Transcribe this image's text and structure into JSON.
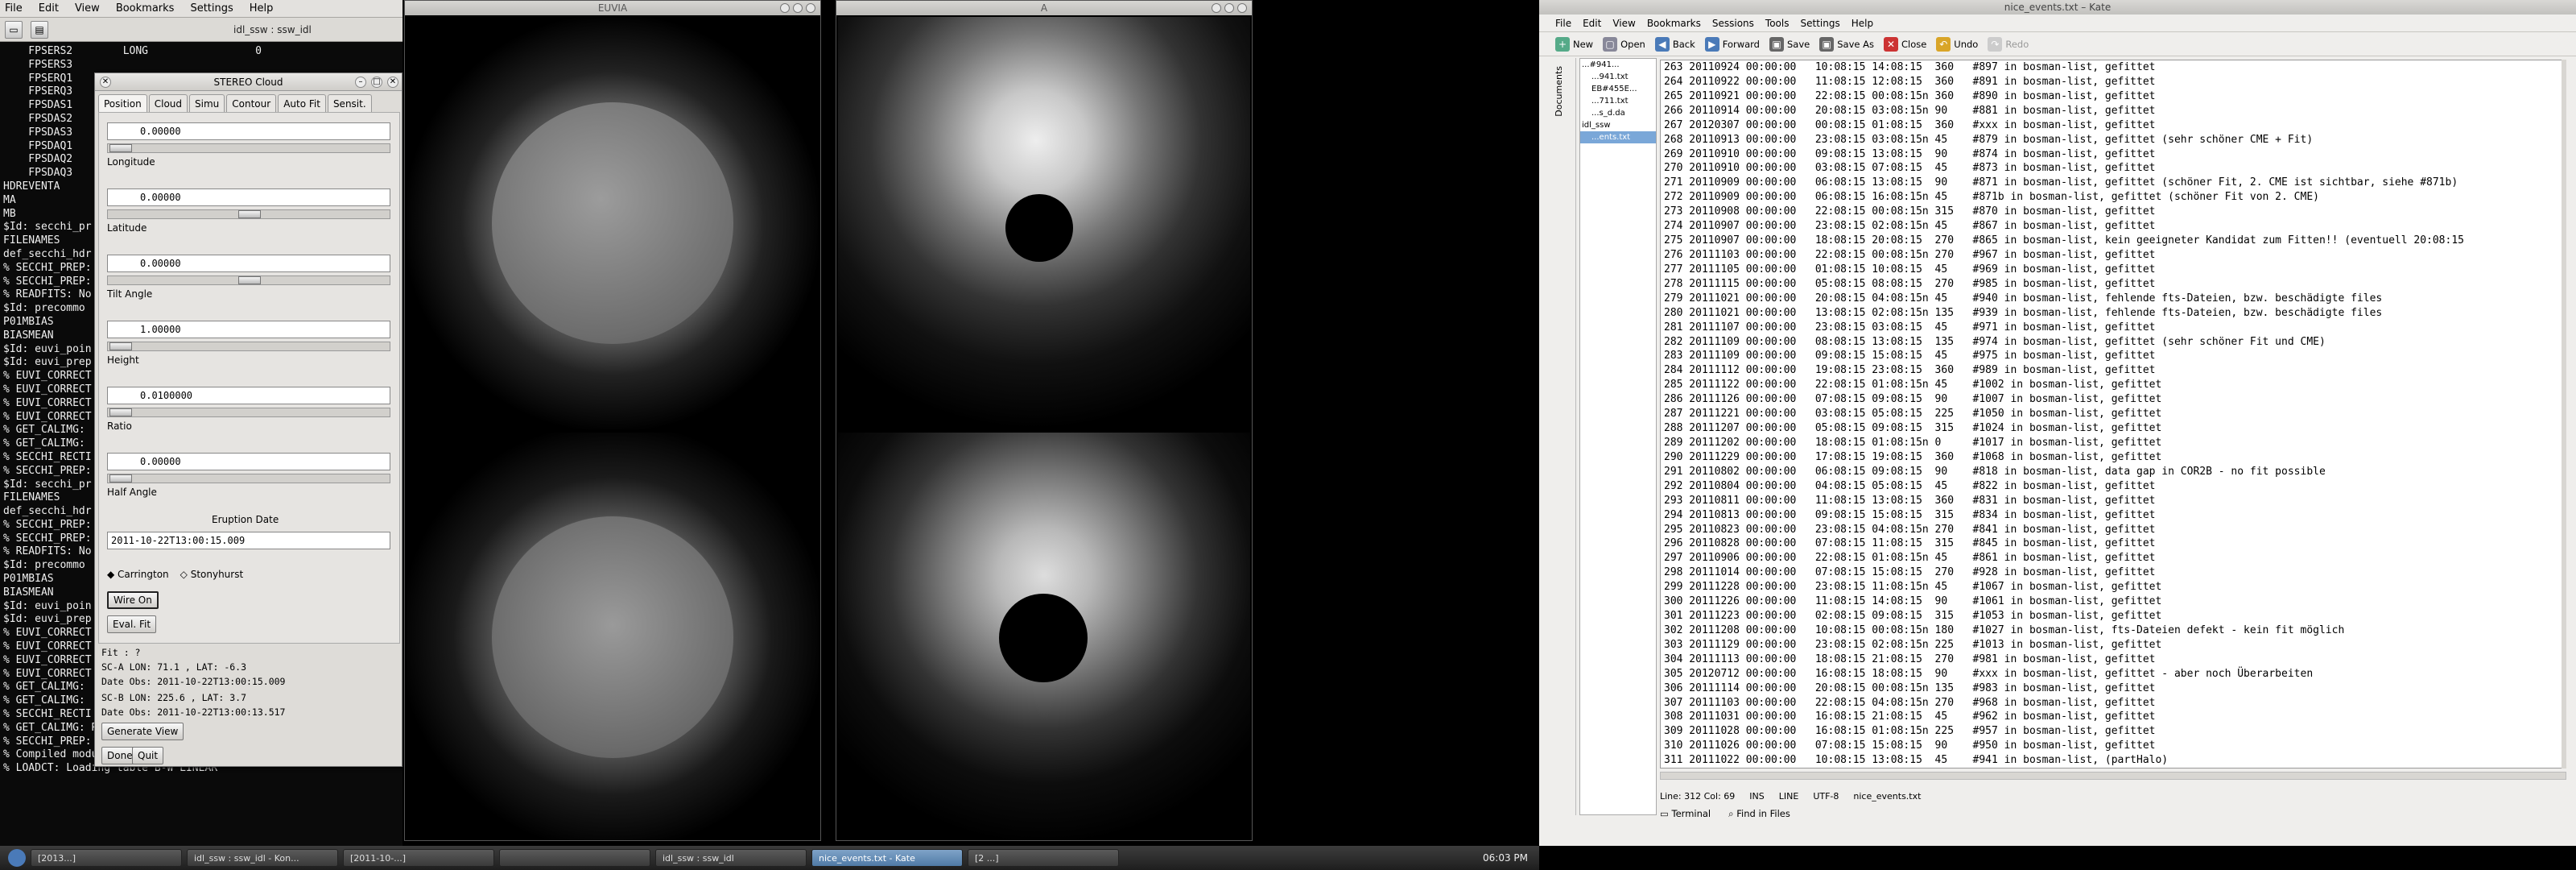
{
  "terminal": {
    "menu": [
      "File",
      "Edit",
      "View",
      "Bookmarks",
      "Settings",
      "Help"
    ],
    "title": "idl_ssw : ssw_idl",
    "lines": [
      "    FPSERS2        LONG                 0",
      "    FPSERS3",
      "    FPSERQ1",
      "",
      "    FPSERQ3",
      "    FPSDAS1",
      "    FPSDAS2",
      "    FPSDAS3",
      "    FPSDAQ1",
      "    FPSDAQ2",
      "    FPSDAQ3",
      "HDREVENTA",
      "MA",
      "MB",
      "",
      "$Id: secchi_pr",
      "FILENAMES",
      "def_secchi_hdr",
      "% SECCHI_PREP:",
      "% SECCHI_PREP:",
      "% READFITS: No",
      "$Id: precommo",
      "P01MBIAS",
      "BIASMEAN",
      "$Id: euvi_poin",
      "$Id: euvi_prep",
      "% EUVI_CORRECT",
      "% EUVI_CORRECT",
      "% EUVI_CORRECT",
      "% EUVI_CORRECT",
      "% GET_CALIMG:",
      "% GET_CALIMG:",
      "% SECCHI_RECTI",
      "% SECCHI_PREP:",
      "",
      "$Id: secchi_pr",
      "FILENAMES",
      "def_secchi_hdr",
      "% SECCHI_PREP:",
      "% SECCHI_PREP:",
      "% READFITS: No",
      "$Id: precommo",
      "P01MBIAS",
      "BIASMEAN",
      "$Id: euvi_poin",
      "$Id: euvi_prep",
      "% EUVI_CORRECT",
      "% EUVI_CORRECT",
      "% EUVI_CORRECT",
      "% EUVI_CORRECT",
      "% GET_CALIMG:",
      "% GET_CALIMG:",
      "% SECCHI_RECTI",
      "% GET_CALIMG: RECTIFIED CALIBRATION IMAGE",
      "% SECCHI_PREP: FINISHED!",
      "% Compiled module: CMECLOUD.",
      "% LOADCT: Loading table B-W LINEAR"
    ]
  },
  "dialog": {
    "title": "STEREO Cloud",
    "tabs": [
      "Position",
      "Cloud",
      "Simu",
      "Contour",
      "Auto Fit",
      "Sensit."
    ],
    "fields": [
      {
        "label": "",
        "value": "0.00000"
      },
      {
        "label": "Longitude",
        "value": "0.00000"
      },
      {
        "label": "Latitude",
        "value": "0.00000"
      },
      {
        "label": "Tilt Angle",
        "value": "1.00000"
      },
      {
        "label": "Height",
        "value": "0.0100000"
      },
      {
        "label": "Ratio",
        "value": "0.00000"
      }
    ],
    "last_label": "Half Angle",
    "eruption_label": "Eruption Date",
    "eruption_value": "2011-10-22T13:00:15.009",
    "radio_carrington": "Carrington",
    "radio_stonyhurst": "Stonyhurst",
    "wire_btn": "Wire On",
    "eval_btn": "Eval. Fit",
    "fit_label": "Fit : ?",
    "sc_a": "SC-A LON:   71.1 , LAT:   -6.3",
    "date_obs_a": "Date Obs: 2011-10-22T13:00:15.009",
    "sc_b": "SC-B LON:  225.6 , LAT:    3.7",
    "date_obs_b": "Date Obs: 2011-10-22T13:00:13.517",
    "generate_btn": "Generate View",
    "done_btn": "Done",
    "quit_btn": "Quit"
  },
  "image_windows": {
    "left_title": "EUVIA",
    "right_title": "A"
  },
  "kate": {
    "title": "nice_events.txt – Kate",
    "menu": [
      "File",
      "Edit",
      "View",
      "Bookmarks",
      "Sessions",
      "Tools",
      "Settings",
      "Help"
    ],
    "toolbar": [
      "New",
      "Open",
      "Back",
      "Forward",
      "Save",
      "Save As",
      "Close",
      "Undo",
      "Redo"
    ],
    "tree_items": [
      "...#941...",
      "...941.txt",
      "EB#455E...",
      "...711.txt",
      "...s_d.da",
      "idl_ssw",
      "...ents.txt"
    ],
    "sidebar_label": "Documents",
    "lines": [
      "263 20110924 00:00:00   10:08:15 14:08:15  360   #897 in bosman-list, gefittet",
      "264 20110922 00:00:00   11:08:15 12:08:15  360   #891 in bosman-list, gefittet",
      "265 20110921 00:00:00   22:08:15 00:08:15n 360   #890 in bosman-list, gefittet",
      "266 20110914 00:00:00   20:08:15 03:08:15n 90    #881 in bosman-list, gefittet",
      "267 20120307 00:00:00   00:08:15 01:08:15  360   #xxx in bosman-list, gefittet",
      "268 20110913 00:00:00   23:08:15 03:08:15n 45    #879 in bosman-list, gefittet (sehr schöner CME + Fit)",
      "269 20110910 00:00:00   09:08:15 13:08:15  90    #874 in bosman-list, gefittet",
      "270 20110910 00:00:00   03:08:15 07:08:15  45    #873 in bosman-list, gefittet",
      "271 20110909 00:00:00   06:08:15 13:08:15  90    #871 in bosman-list, gefittet (schöner Fit, 2. CME ist sichtbar, siehe #871b)",
      "272 20110909 00:00:00   06:08:15 16:08:15n 45    #871b in bosman-list, gefittet (schöner Fit von 2. CME)",
      "273 20110908 00:00:00   22:08:15 00:08:15n 315   #870 in bosman-list, gefittet",
      "274 20110907 00:00:00   23:08:15 02:08:15n 45    #867 in bosman-list, gefittet",
      "275 20110907 00:00:00   18:08:15 20:08:15  270   #865 in bosman-list, kein geeigneter Kandidat zum Fitten!! (eventuell 20:08:15",
      "276 20111103 00:00:00   22:08:15 00:08:15n 270   #967 in bosman-list, gefittet",
      "277 20111105 00:00:00   01:08:15 10:08:15  45    #969 in bosman-list, gefittet",
      "278 20111115 00:00:00   05:08:15 08:08:15  270   #985 in bosman-list, gefittet",
      "279 20111021 00:00:00   20:08:15 04:08:15n 45    #940 in bosman-list, fehlende fts-Dateien, bzw. beschädigte files",
      "280 20111021 00:00:00   13:08:15 02:08:15n 135   #939 in bosman-list, fehlende fts-Dateien, bzw. beschädigte files",
      "281 20111107 00:00:00   23:08:15 03:08:15  45    #971 in bosman-list, gefittet",
      "282 20111109 00:00:00   08:08:15 13:08:15  135   #974 in bosman-list, gefittet (sehr schöner Fit und CME)",
      "283 20111109 00:00:00   09:08:15 15:08:15  45    #975 in bosman-list, gefittet",
      "284 20111112 00:00:00   19:08:15 23:08:15  360   #989 in bosman-list, gefittet",
      "285 20111122 00:00:00   22:08:15 01:08:15n 45    #1002 in bosman-list, gefittet",
      "286 20111126 00:00:00   07:08:15 09:08:15  90    #1007 in bosman-list, gefittet",
      "287 20111221 00:00:00   03:08:15 05:08:15  225   #1050 in bosman-list, gefittet",
      "288 20111207 00:00:00   05:08:15 09:08:15  315   #1024 in bosman-list, gefittet",
      "289 20111202 00:00:00   18:08:15 01:08:15n 0     #1017 in bosman-list, gefittet",
      "290 20111229 00:00:00   17:08:15 19:08:15  360   #1068 in bosman-list, gefittet",
      "291 20110802 00:00:00   06:08:15 09:08:15  90    #818 in bosman-list, data gap in COR2B - no fit possible",
      "292 20110804 00:00:00   04:08:15 05:08:15  45    #822 in bosman-list, gefittet",
      "293 20110811 00:00:00   11:08:15 13:08:15  360   #831 in bosman-list, gefittet",
      "294 20110813 00:00:00   09:08:15 15:08:15  315   #834 in bosman-list, gefittet",
      "295 20110823 00:00:00   23:08:15 04:08:15n 270   #841 in bosman-list, gefittet",
      "296 20110828 00:00:00   07:08:15 11:08:15  315   #845 in bosman-list, gefittet",
      "297 20110906 00:00:00   22:08:15 01:08:15n 45    #861 in bosman-list, gefittet",
      "298 20111014 00:00:00   07:08:15 15:08:15  270   #928 in bosman-list, gefittet",
      "299 20111228 00:00:00   23:08:15 11:08:15n 45    #1067 in bosman-list, gefittet",
      "300 20111226 00:00:00   11:08:15 14:08:15  90    #1061 in bosman-list, gefittet",
      "301 20111223 00:00:00   02:08:15 09:08:15  315   #1053 in bosman-list, gefittet",
      "302 20111208 00:00:00   10:08:15 00:08:15n 180   #1027 in bosman-list, fts-Dateien defekt - kein fit möglich",
      "303 20111129 00:00:00   23:08:15 02:08:15n 225   #1013 in bosman-list, gefittet",
      "304 20111113 00:00:00   18:08:15 21:08:15  270   #981 in bosman-list, gefittet",
      "305 20120712 00:00:00   16:08:15 18:08:15  90    #xxx in bosman-list, gefittet - aber noch Überarbeiten",
      "306 20111114 00:00:00   20:08:15 00:08:15n 135   #983 in bosman-list, gefittet",
      "307 20111103 00:00:00   22:08:15 04:08:15n 270   #968 in bosman-list, gefittet",
      "308 20111031 00:00:00   16:08:15 21:08:15  45    #962 in bosman-list, gefittet",
      "309 20111028 00:00:00   16:08:15 01:08:15n 225   #957 in bosman-list, gefittet",
      "310 20111026 00:00:00   07:08:15 15:08:15  90    #950 in bosman-list, gefittet",
      "311 20111022 00:00:00   10:08:15 13:08:15  45    #941 in bosman-list, (partHalo)"
    ],
    "status": [
      "Line: 312 Col: 69",
      "INS",
      "LINE",
      "UTF-8",
      "nice_events.txt"
    ],
    "bottom_tabs": [
      "Terminal",
      "Find in Files"
    ]
  },
  "taskbar": {
    "tasks": [
      "[2013...]",
      "idl_ssw : ssw_idl - Kon...",
      "[2011-10-...]",
      "",
      "idl_ssw : ssw_idl",
      "nice_events.txt - Kate",
      "[2 ...]"
    ],
    "clock": "06:03 PM"
  }
}
